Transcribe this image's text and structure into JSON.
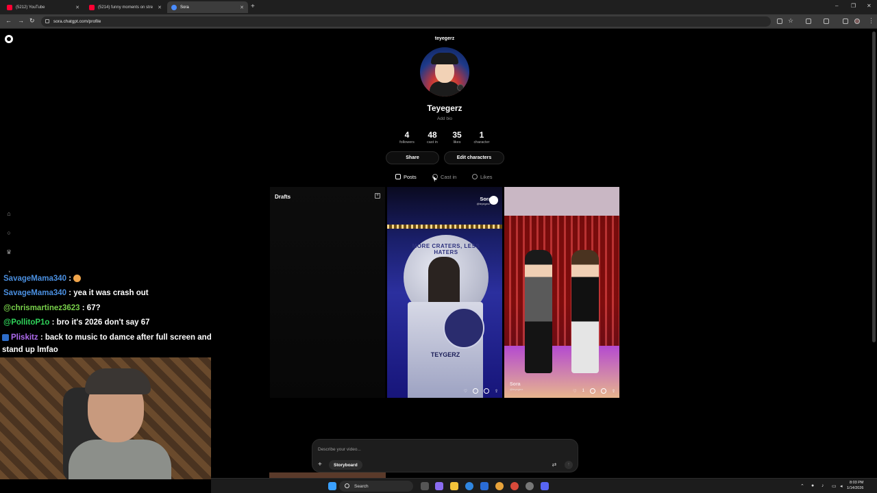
{
  "browser": {
    "tabs": [
      {
        "title": "(5212) YouTube",
        "active": false
      },
      {
        "title": "(5214) funny moments on stre",
        "active": false
      },
      {
        "title": "Sora",
        "active": true
      }
    ],
    "url": "sora.chatgpt.com/profile"
  },
  "profile": {
    "handle": "teyegerz",
    "display_name": "Teyegerz",
    "bio_placeholder": "Add bio",
    "stats": [
      {
        "value": "4",
        "label": "followers"
      },
      {
        "value": "48",
        "label": "cast in"
      },
      {
        "value": "35",
        "label": "likes"
      },
      {
        "value": "1",
        "label": "character"
      }
    ],
    "buttons": {
      "share": "Share",
      "edit_characters": "Edit characters"
    },
    "tabs": [
      {
        "label": "Posts",
        "active": true
      },
      {
        "label": "Cast in",
        "active": false
      },
      {
        "label": "Likes",
        "active": false
      }
    ]
  },
  "grid": {
    "drafts_label": "Drafts",
    "video1": {
      "watermark": "Sora",
      "watermark_handle": "@teyegerz",
      "banner": "MORE CRATERS, LESS HATERS",
      "podium_name": "TEYGERZ"
    },
    "video2": {
      "watermark": "Sora",
      "watermark_handle": "@teyegerz",
      "like_count": "1"
    }
  },
  "composer": {
    "placeholder": "Describe your video...",
    "storyboard_label": "Storyboard"
  },
  "chat": [
    {
      "user": "SavageMama340",
      "text": " : ",
      "color": "#4a8fe0",
      "emote": true
    },
    {
      "user": "SavageMama340",
      "text": " : yea it was crash out",
      "color": "#4a8fe0"
    },
    {
      "user": "@chrismartinez3623",
      "text": " : 67?",
      "color": "#78d04a"
    },
    {
      "user": "@PollitoP1o",
      "text": " : bro it's 2026 don't say 67",
      "color": "#2fd45a"
    },
    {
      "user": "Pliskitz",
      "text": " : back to music to damce after full screen and",
      "color": "#b06cf0",
      "badge": true
    },
    {
      "user": "",
      "text": "stand up lmfao",
      "color": "#ffffff"
    }
  ],
  "taskbar": {
    "search_label": "Search",
    "time": "8:03 PM",
    "date": "1/14/2026"
  }
}
